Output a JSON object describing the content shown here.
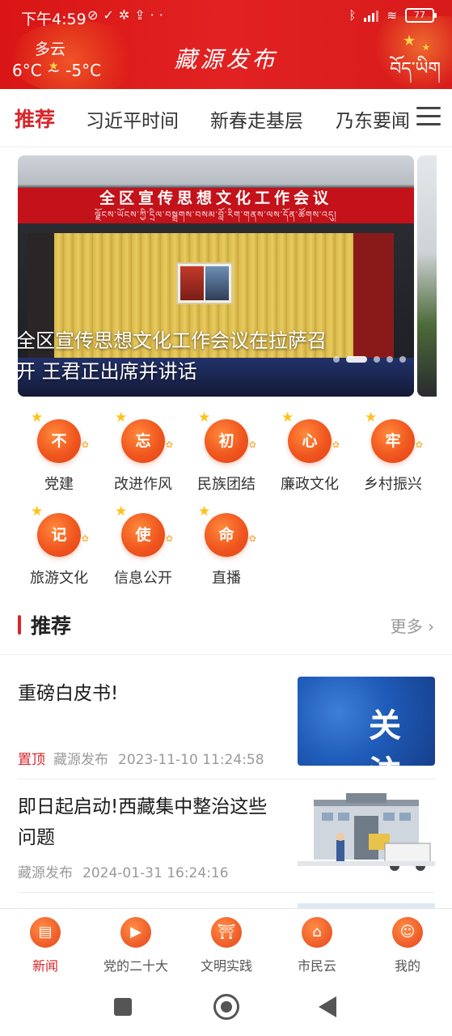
{
  "status_bar": {
    "time": "下午4:59",
    "battery": "77"
  },
  "header": {
    "weather_condition": "多云",
    "weather_temp": "6°C ~ -5°C",
    "app_title": "藏源发布",
    "tibetan_logo": "བོད་ཡིག"
  },
  "tabs": [
    {
      "label": "推荐",
      "active": true
    },
    {
      "label": "习近平时间"
    },
    {
      "label": "新春走基层"
    },
    {
      "label": "乃东要闻"
    }
  ],
  "carousel": {
    "banner_text": "全区宣传思想文化工作会议",
    "banner_tibetan": "ལྗོངས་ཡོངས་ཀྱི་དྲིལ་བསྒྲགས་བསམ་བློ་རིག་གནས་ལས་དོན་ཚོགས་འདུ།",
    "caption": "全区宣传思想文化工作会议在拉萨召开 王君正出席并讲话",
    "slide_count": 5,
    "active_index": 1
  },
  "categories": [
    {
      "label": "党建",
      "glyph": "不"
    },
    {
      "label": "改进作风",
      "glyph": "忘"
    },
    {
      "label": "民族团结",
      "glyph": "初"
    },
    {
      "label": "廉政文化",
      "glyph": "心"
    },
    {
      "label": "乡村振兴",
      "glyph": "牢"
    },
    {
      "label": "旅游文化",
      "glyph": "记"
    },
    {
      "label": "信息公开",
      "glyph": "使"
    },
    {
      "label": "直播",
      "glyph": "命"
    }
  ],
  "section": {
    "title": "推荐",
    "more": "更多"
  },
  "news": [
    {
      "title": "重磅白皮书!",
      "tag": "置顶",
      "source": "藏源发布",
      "time": "2023-11-10 11:24:58",
      "thumb_text": "关注"
    },
    {
      "title": "即日起启动!西藏集中整治这些问题",
      "source": "藏源发布",
      "time": "2024-01-31 16:24:16"
    }
  ],
  "bottom_nav": [
    {
      "label": "新闻",
      "icon": "newspaper-icon",
      "active": true
    },
    {
      "label": "党的二十大",
      "icon": "video-icon"
    },
    {
      "label": "文明实践",
      "icon": "gate-icon"
    },
    {
      "label": "市民云",
      "icon": "people-icon"
    },
    {
      "label": "我的",
      "icon": "person-icon"
    }
  ],
  "colors": {
    "brand_red": "#e22222",
    "accent_red": "#d8262b",
    "icon_orange": "#f0561e"
  }
}
